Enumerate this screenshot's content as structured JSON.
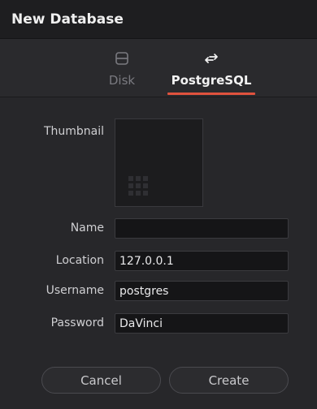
{
  "dialog": {
    "title": "New Database"
  },
  "tabs": [
    {
      "label": "Disk",
      "icon": "disk-icon",
      "selected": false
    },
    {
      "label": "PostgreSQL",
      "icon": "swap-arrows-icon",
      "selected": true
    }
  ],
  "form": {
    "thumbnail_label": "Thumbnail",
    "name_label": "Name",
    "name_value": "",
    "location_label": "Location",
    "location_value": "127.0.0.1",
    "username_label": "Username",
    "username_value": "postgres",
    "password_label": "Password",
    "password_value": "DaVinci"
  },
  "buttons": {
    "cancel": "Cancel",
    "create": "Create"
  },
  "colors": {
    "accent": "#e0523e",
    "background": "#27272a",
    "field": "#151517"
  }
}
